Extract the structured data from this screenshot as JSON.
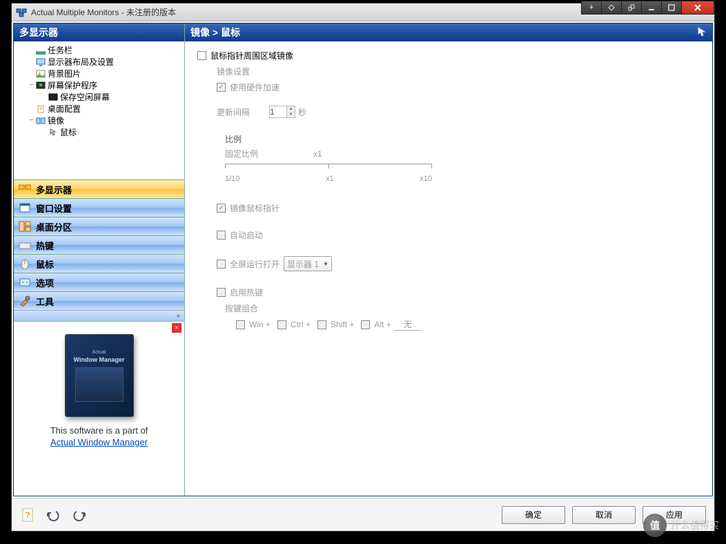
{
  "window": {
    "title": "Actual Multiple Monitors - 未注册的版本"
  },
  "sidebar": {
    "header": "多显示器",
    "tree": [
      {
        "label": "任务栏",
        "indent": 1,
        "icon": "taskbar"
      },
      {
        "label": "显示器布局及设置",
        "indent": 1,
        "icon": "monitor"
      },
      {
        "label": "背景图片",
        "indent": 1,
        "icon": "picture"
      },
      {
        "label": "屏幕保护程序",
        "indent": 1,
        "icon": "screensaver",
        "exp": "−"
      },
      {
        "label": "保存空闲屏幕",
        "indent": 2,
        "icon": "screen"
      },
      {
        "label": "桌面配置",
        "indent": 1,
        "icon": "profile"
      },
      {
        "label": "镜像",
        "indent": 1,
        "icon": "mirror",
        "exp": "−"
      },
      {
        "label": "鼠标",
        "indent": 2,
        "icon": "mouse",
        "sel": true
      }
    ],
    "categories": [
      {
        "label": "多显示器",
        "active": true
      },
      {
        "label": "窗口设置"
      },
      {
        "label": "桌面分区"
      },
      {
        "label": "热键"
      },
      {
        "label": "鼠标"
      },
      {
        "label": "选项"
      },
      {
        "label": "工具"
      }
    ],
    "promo": {
      "box_title": "Window Manager",
      "text": "This software is a part of",
      "link": "Actual Window Manager"
    }
  },
  "main": {
    "breadcrumb": "镜像 > 鼠标",
    "opt_mirror_area": "鼠标指针周围区域镜像",
    "mirror_settings": "镜像设置",
    "hw_accel": "使用硬件加速",
    "update_interval_label": "更新间隔",
    "update_interval_value": "1",
    "update_interval_unit": "秒",
    "scale_label": "比例",
    "fixed_scale_label": "固定比例",
    "fixed_scale_val": "x1",
    "scale_min": "1/10",
    "scale_mid": "x1",
    "scale_max": "x10",
    "mirror_cursor": "镜像鼠标指针",
    "auto_start": "自动启动",
    "fullscreen_open": "全屏运行打开",
    "monitor_option": "显示器 1",
    "enable_hotkey": "启用热键",
    "hotkey_combo_label": "按键组合",
    "hk_win": "Win +",
    "hk_ctrl": "Ctrl +",
    "hk_shift": "Shift +",
    "hk_alt": "Alt +",
    "hk_none": "无"
  },
  "footer": {
    "ok": "确定",
    "cancel": "取消",
    "apply": "应用"
  },
  "watermark": {
    "badge": "值",
    "text": "什么值得买"
  }
}
